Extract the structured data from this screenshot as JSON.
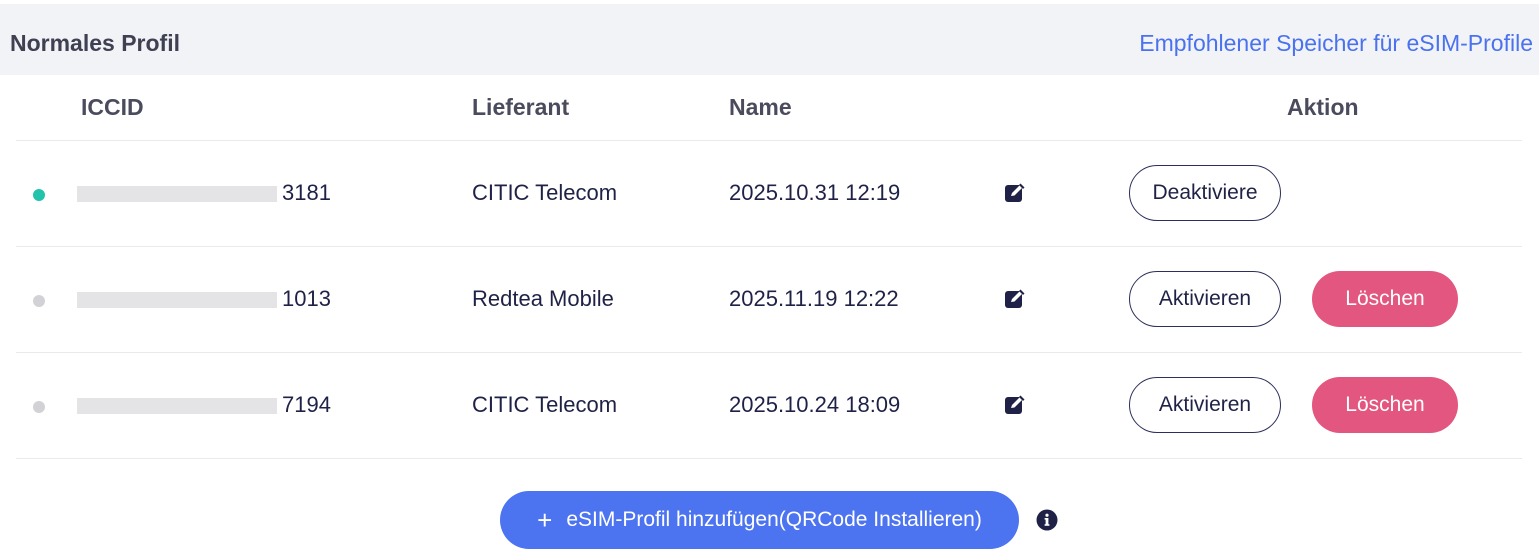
{
  "header": {
    "title": "Normales Profil",
    "link": "Empfohlener Speicher für eSIM-Profile"
  },
  "columns": {
    "iccid": "ICCID",
    "provider": "Lieferant",
    "name": "Name",
    "action": "Aktion"
  },
  "rows": [
    {
      "status": "active",
      "iccid_suffix": "3181",
      "provider": "CITIC Telecom",
      "name": "2025.10.31 12:19",
      "primary_action": "Deaktiviere",
      "delete_action": null
    },
    {
      "status": "inactive",
      "iccid_suffix": "1013",
      "provider": "Redtea Mobile",
      "name": "2025.11.19 12:22",
      "primary_action": "Aktivieren",
      "delete_action": "Löschen"
    },
    {
      "status": "inactive",
      "iccid_suffix": "7194",
      "provider": "CITIC Telecom",
      "name": "2025.10.24 18:09",
      "primary_action": "Aktivieren",
      "delete_action": "Löschen"
    }
  ],
  "add_button": {
    "icon": "plus-icon",
    "label": "eSIM-Profil hinzufügen(QRCode Installieren)"
  },
  "icons": {
    "edit": "edit-icon",
    "info": "info-icon"
  },
  "colors": {
    "accent_blue": "#4c73f0",
    "link_blue": "#4a72ee",
    "active_dot": "#22c3ad",
    "inactive_dot": "#d2d2d6",
    "delete_pink": "#e2567f",
    "text_dark": "#1f2246"
  }
}
